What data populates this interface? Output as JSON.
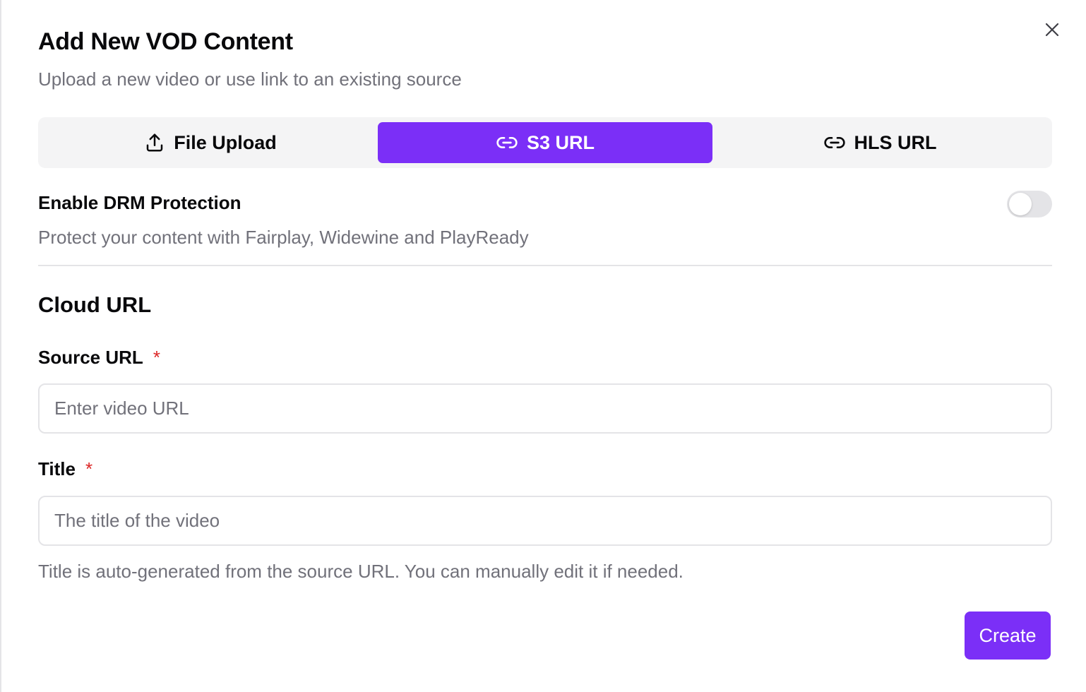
{
  "dialog": {
    "title": "Add New VOD Content",
    "subtitle": "Upload a new video or use link to an existing source"
  },
  "tabs": [
    {
      "label": "File Upload",
      "icon": "upload-icon",
      "active": false
    },
    {
      "label": "S3 URL",
      "icon": "link-icon",
      "active": true
    },
    {
      "label": "HLS URL",
      "icon": "link-icon",
      "active": false
    }
  ],
  "drm": {
    "label": "Enable DRM Protection",
    "description": "Protect your content with Fairplay, Widewine and PlayReady",
    "enabled": false
  },
  "section": {
    "title": "Cloud URL"
  },
  "fields": {
    "source_url": {
      "label": "Source URL",
      "required_marker": "*",
      "value": "",
      "placeholder": "Enter video URL"
    },
    "title": {
      "label": "Title",
      "required_marker": "*",
      "value": "",
      "placeholder": "The title of the video",
      "hint": "Title is auto-generated from the source URL. You can manually edit it if needed."
    }
  },
  "actions": {
    "create_label": "Create"
  },
  "colors": {
    "accent": "#7b2ff7",
    "required": "#dc2626",
    "muted_text": "#71717a"
  }
}
